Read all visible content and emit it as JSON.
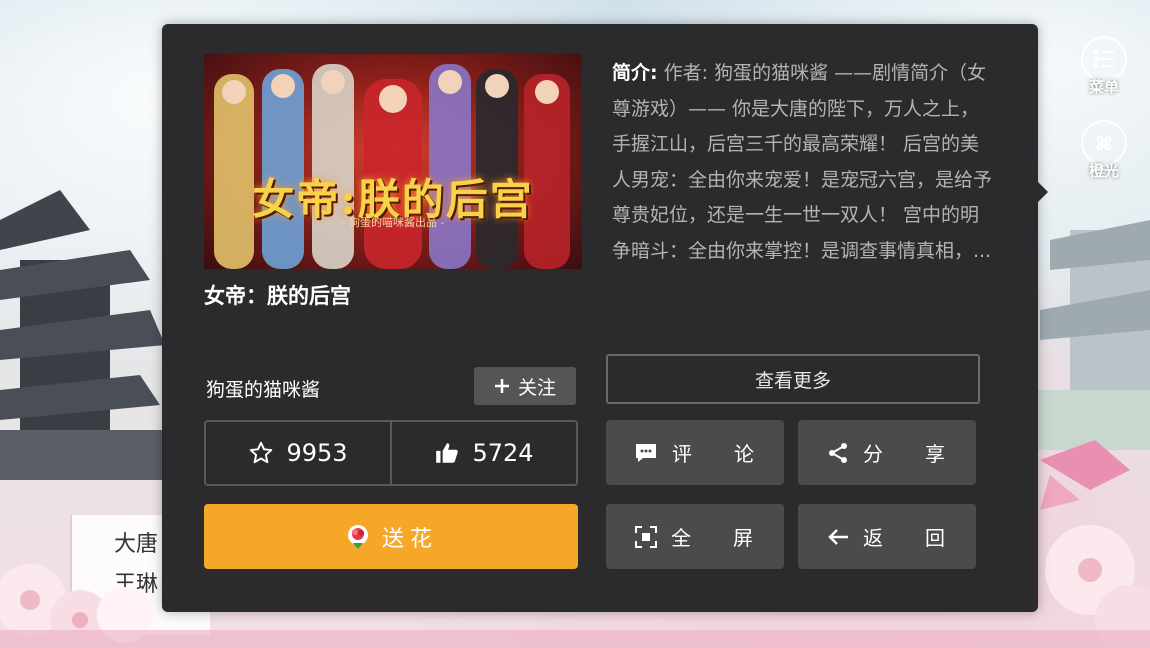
{
  "side_menu": {
    "menu_label": "菜单",
    "light_label": "橙光"
  },
  "background": {
    "story_line1": "大唐",
    "story_line2": "王琳"
  },
  "book": {
    "cover_title": "女帝:朕的后宫",
    "cover_subtitle": "- 狗蛋的喵咪酱出品 -",
    "title": "女帝：朕的后宫",
    "intro_label": "简介:",
    "intro_text": "作者: 狗蛋的猫咪酱 ——剧情简介（女尊游戏）—— 你是大唐的陛下，万人之上，手握江山，后宫三千的最高荣耀！ 后宫的美人男宠：全由你来宠爱！是宠冠六宫，是给予尊贵妃位，还是一生一世一双人！ 宫中的明争暗斗：全由你来掌控！是调查事情真相，..."
  },
  "author": {
    "name": "狗蛋的猫咪酱",
    "follow_label": "关注"
  },
  "stats": {
    "favorites": "9953",
    "likes": "5724"
  },
  "actions": {
    "send_flower": "送花",
    "see_more": "查看更多",
    "comment_a": "评",
    "comment_b": "论",
    "share_a": "分",
    "share_b": "享",
    "fullscreen_a": "全",
    "fullscreen_b": "屏",
    "back_a": "返",
    "back_b": "回"
  },
  "colors": {
    "panel_bg": "#2b2b2d",
    "accent_orange": "#f7a727",
    "button_gray": "#4b4b4e"
  }
}
